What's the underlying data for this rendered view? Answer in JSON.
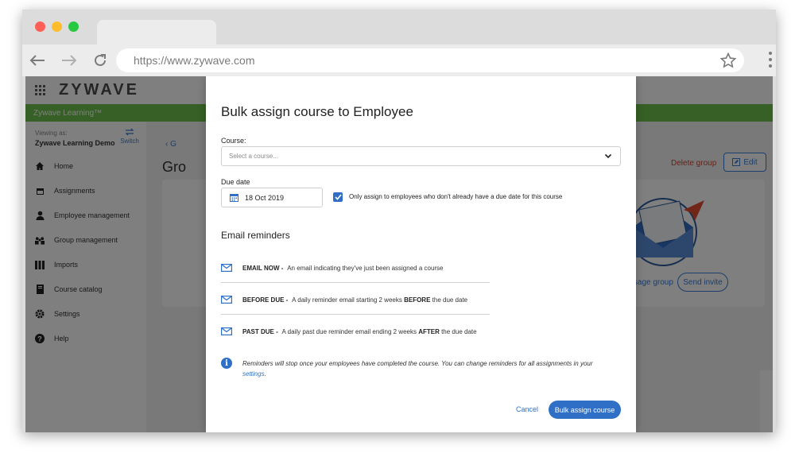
{
  "browser": {
    "url": "https://www.zywave.com",
    "traffic_colors": [
      "#ff5f57",
      "#ffbd2e",
      "#28c840"
    ]
  },
  "app": {
    "logo": "ZYWAVE",
    "product": "Zywave Learning™",
    "viewing_label": "Viewing as:",
    "viewing_value": "Zywave Learning Demo",
    "switch_label": "Switch",
    "sidebar": [
      {
        "label": "Home",
        "icon": "home-icon"
      },
      {
        "label": "Assignments",
        "icon": "calendar-icon"
      },
      {
        "label": "Employee management",
        "icon": "person-icon"
      },
      {
        "label": "Group management",
        "icon": "group-icon"
      },
      {
        "label": "Imports",
        "icon": "imports-icon"
      },
      {
        "label": "Course catalog",
        "icon": "book-icon"
      },
      {
        "label": "Settings",
        "icon": "gear-icon"
      },
      {
        "label": "Help",
        "icon": "help-icon"
      }
    ],
    "back_label": "G",
    "page_title": "Gro",
    "delete_group": "Delete group",
    "edit": "Edit",
    "message_group": "Message group",
    "send_invite": "Send invite"
  },
  "modal": {
    "title": "Bulk assign course to Employee",
    "course_label": "Course:",
    "course_placeholder": "Select a course...",
    "due_date_label": "Due date",
    "due_date_value": "18 Oct 2019",
    "checkbox_checked": true,
    "checkbox_label": "Only assign to employees who don't already have a due date for this course",
    "email_reminders_title": "Email reminders",
    "reminders": [
      {
        "strong": "EMAIL NOW -",
        "text": " An email indicating they've just been assigned a course"
      },
      {
        "strong": "BEFORE DUE -",
        "text": " A daily reminder email starting 2 weeks ",
        "em": "BEFORE",
        "tail": " the due date"
      },
      {
        "strong": "PAST DUE -",
        "text": " A daily past due reminder email ending 2 weeks ",
        "em": "AFTER",
        "tail": " the due date"
      }
    ],
    "info_text": "Reminders will stop once your employees have completed the course. You can change reminders for all assignments in your ",
    "info_link": "settings",
    "info_end": ".",
    "cancel": "Cancel",
    "submit": "Bulk assign course"
  },
  "colors": {
    "primary": "#2f6fc5",
    "green_bar": "#6dc04b",
    "danger": "#c9452f"
  }
}
